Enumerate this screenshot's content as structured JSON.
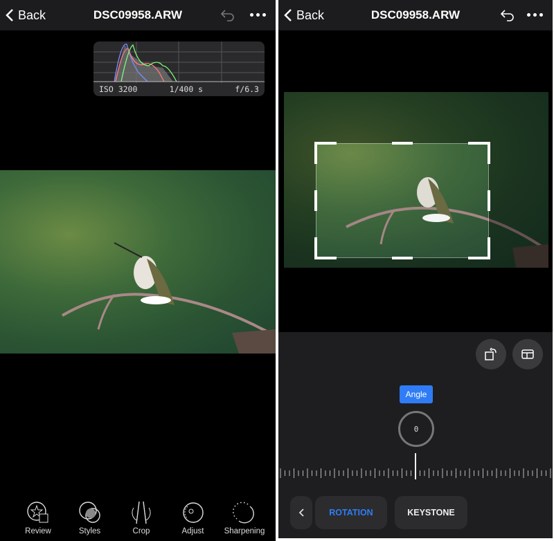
{
  "left": {
    "header": {
      "back_label": "Back",
      "title": "DSC09958.ARW"
    },
    "histogram": {
      "iso": "ISO 3200",
      "shutter": "1/400 s",
      "aperture": "f/6.3"
    },
    "toolbar": [
      {
        "label": "Review",
        "icon": "review-icon"
      },
      {
        "label": "Styles",
        "icon": "styles-icon"
      },
      {
        "label": "Crop",
        "icon": "crop-icon"
      },
      {
        "label": "Adjust",
        "icon": "adjust-icon"
      },
      {
        "label": "Sharpening",
        "icon": "sharpening-icon"
      }
    ]
  },
  "right": {
    "header": {
      "back_label": "Back",
      "title": "DSC09958.ARW"
    },
    "angle_label": "Angle",
    "angle_value": "0",
    "tabs": {
      "rotation": "ROTATION",
      "keystone": "KEYSTONE",
      "active": "ROTATION"
    },
    "colors": {
      "accent": "#2f7cf6"
    }
  }
}
